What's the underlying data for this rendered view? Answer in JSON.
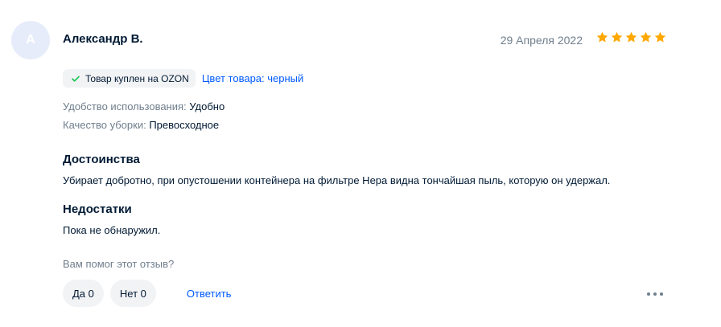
{
  "review": {
    "avatar_letter": "A",
    "author": "Александр В.",
    "date": "29 Апреля 2022",
    "rating": 5,
    "rating_max": 5,
    "star_color": "#ffa800",
    "badge": {
      "icon": "check-icon",
      "text": "Товар куплен на OZON",
      "check_color": "#10c44c"
    },
    "product_color_link": "Цвет товара: черный",
    "attributes": [
      {
        "label": "Удобство использования:",
        "value": "Удобно"
      },
      {
        "label": "Качество уборки:",
        "value": "Превосходное"
      }
    ],
    "advantages": {
      "title": "Достоинства",
      "text": "Убирает добротно, при опустошении контейнера на фильтре Hepa видна тончайшая пыль, которую он удержал."
    },
    "disadvantages": {
      "title": "Недостатки",
      "text": "Пока не обнаружил."
    },
    "helpful_prompt": "Вам помог этот отзыв?",
    "vote_yes": "Да 0",
    "vote_no": "Нет 0",
    "reply_label": "Ответить",
    "more_icon": "more-dots-icon",
    "link_color": "#005bff"
  }
}
